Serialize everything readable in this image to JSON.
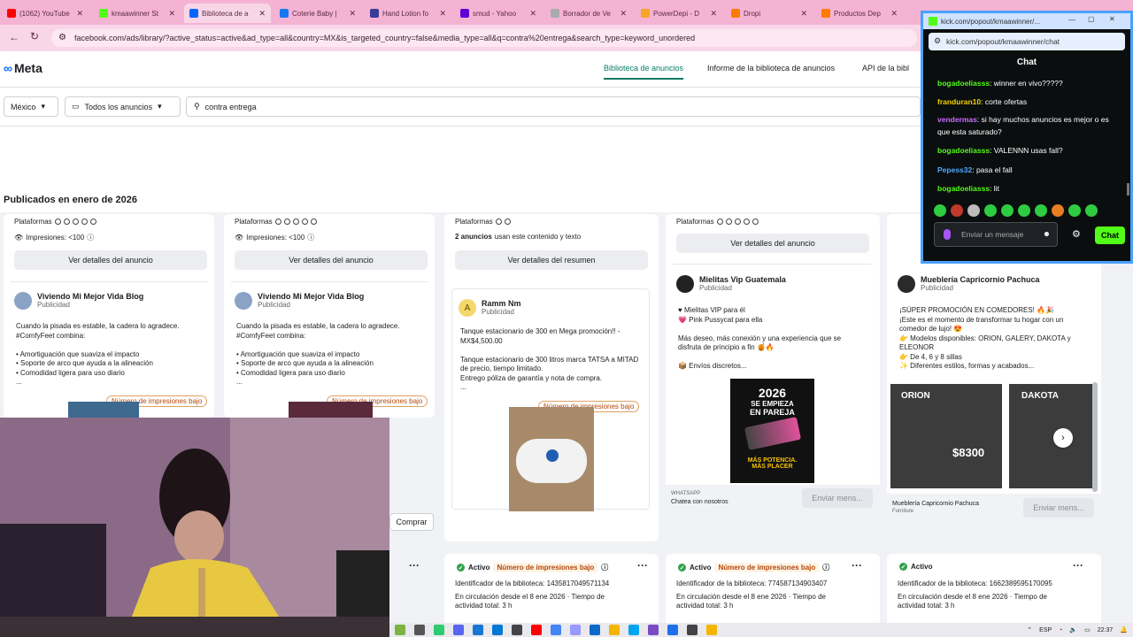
{
  "browser": {
    "tabs": [
      {
        "label": "(1062) YouTube",
        "color": "#ff0000"
      },
      {
        "label": "kmaawinner St",
        "color": "#53fc18"
      },
      {
        "label": "Biblioteca de a",
        "color": "#0866ff"
      },
      {
        "label": "Coterie Baby |",
        "color": "#1877f2"
      },
      {
        "label": "Hand Lotion fo",
        "color": "#3b3b98"
      },
      {
        "label": "smud - Yahoo",
        "color": "#6001d2"
      },
      {
        "label": "Borrador de Ve",
        "color": "#aaaaaa"
      },
      {
        "label": "PowerDepi - D",
        "color": "#f5a623"
      },
      {
        "label": "Dropi",
        "color": "#ff7a00"
      },
      {
        "label": "Productos Dep",
        "color": "#ff7a00"
      }
    ],
    "url": "facebook.com/ads/library/?active_status=active&ad_type=all&country=MX&is_targeted_country=false&media_type=all&q=contra%20entrega&search_type=keyword_unordered"
  },
  "meta": {
    "logo": "Meta",
    "nav": [
      "Biblioteca de anuncios",
      "Informe de la biblioteca de anuncios",
      "API de la bibl"
    ],
    "filters": {
      "country": "México",
      "ad_type": "Todos los anuncios",
      "query": "contra entrega"
    },
    "published_heading": "Publicados en enero de 2026",
    "platforms_label": "Plataformas",
    "impressions_label": "Impresiones: <100",
    "view_ad_details": "Ver detalles del anuncio",
    "view_summary": "Ver detalles del resumen",
    "two_ads": "2 anuncios",
    "two_ads_rest": "usan este contenido y texto",
    "low_impressions": "Número de impresiones bajo",
    "sponsored": "Publicidad",
    "buy": "Comprar",
    "send_message": "Enviar mens...",
    "cards": [
      {
        "advertiser": "Viviendo Mi Mejor Vida Blog",
        "body": "Cuando la pisada es estable, la cadera lo agradece.\n#ComfyFeet combina:\n\n• Amortiguación que suaviza el impacto\n• Soporte de arco que ayuda a la alineación\n• Comodidad ligera para uso diario\n..."
      },
      {
        "advertiser": "Viviendo Mi Mejor Vida Blog",
        "body": "Cuando la pisada es estable, la cadera lo agradece.\n#ComfyFeet combina:\n\n• Amortiguación que suaviza el impacto\n• Soporte de arco que ayuda a la alineación\n• Comodidad ligera para uso diario\n..."
      },
      {
        "advertiser": "Ramm Nm",
        "avatar_letter": "A",
        "body": "Tanque estacionario de 300 en Mega promoción!! -\nMX$4,500.00\n\nTanque estacionario de 300 litros marca TATSA a MITAD\nde precio, tiempo limitado.\nEntrego póliza de garantía y nota de compra.\n..."
      },
      {
        "advertiser": "Mielitas Vip Guatemala",
        "body": "♥ Mielitas VIP para él\n💗 Pink Pussycat para ella\n\nMás deseo, más conexión y una experiencia que se\ndisfruta de principio a fin 🍯🔥\n\n📦 Envíos discretos...",
        "media_lines": [
          "2026",
          "SE EMPIEZA",
          "EN PAREJA",
          "MÁS POTENCIA.",
          "MÁS PLACER"
        ],
        "footer_1": "WHATSAPP",
        "footer_2": "Chatea con nosotros"
      },
      {
        "advertiser": "Mueblería Capricornio Pachuca",
        "body": "¡SÚPER PROMOCIÓN EN COMEDORES! 🔥🎉\n¡Este es el momento de transformar tu hogar con un\ncomedor de lujo! 😍\n👉 Modelos disponibles: ORION, GALERY, DAKOTA y\nELEONOR\n👉 De 4, 6 y 8 sillas\n✨ Diferentes estilos, formas y acabados...",
        "media_1": "ORION",
        "media_price": "$8300",
        "media_2": "DAKOTA",
        "footer_1": "Mueblería Capricornio Pachuca",
        "footer_2": "Furniture"
      }
    ],
    "bottom_cards": [
      {
        "status": "Activo",
        "low": "Número de impresiones bajo",
        "id": "Identificador de la biblioteca: 1435817049571134",
        "run": "En circulación desde el 8 ene 2026 · Tiempo de actividad total: 3 h"
      },
      {
        "status": "Activo",
        "low": "Número de impresiones bajo",
        "id": "Identificador de la biblioteca: 774587134903407",
        "run": "En circulación desde el 8 ene 2026 · Tiempo de actividad total: 3 h"
      },
      {
        "status": "Activo",
        "low": "",
        "id": "Identificador de la biblioteca: 1662389595170095",
        "run": "En circulación desde el 8 ene 2026 · Tiempo de actividad total: 3 h"
      }
    ]
  },
  "chat": {
    "window_url": "kick.com/popout/kmaawinner/...",
    "url": "kick.com/popout/kmaawinner/chat",
    "title": "Chat",
    "messages": [
      {
        "user": "bogadoeliasss",
        "text": ": winner en vivo?????",
        "color": "#53fc18"
      },
      {
        "user": "franduran10",
        "text": ": corte ofertas",
        "color": "#f5d100"
      },
      {
        "user": "vendermas",
        "text": ": si hay muchos anuncios es mejor o es que esta saturado?",
        "color": "#c96bff"
      },
      {
        "user": "bogadoeliasss",
        "text": ": VALENNN usas fall?",
        "color": "#53fc18"
      },
      {
        "user": "Pepess32",
        "text": ": pasa el fall",
        "color": "#4fa8ff"
      },
      {
        "user": "bogadoeliasss",
        "text": ": lit",
        "color": "#53fc18"
      }
    ],
    "input_placeholder": "Enviar un mensaje",
    "send_label": "Chat"
  },
  "taskbar": {
    "lang": "ESP",
    "time": "22:37"
  }
}
